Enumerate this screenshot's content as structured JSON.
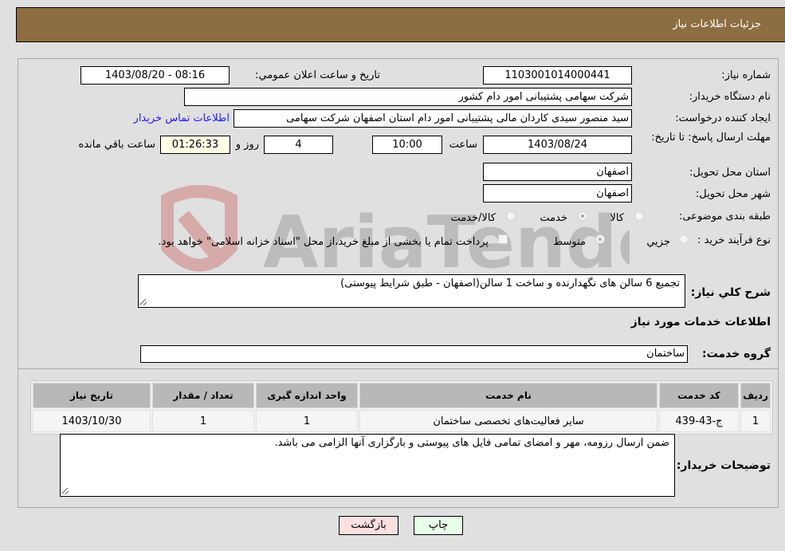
{
  "header": {
    "title": "جزئیات اطلاعات نیاز"
  },
  "form": {
    "need_number": {
      "label": "شماره نیاز:",
      "value": "1103001014000441"
    },
    "announce_datetime": {
      "label": "تاریخ و ساعت اعلان عمومي:",
      "value": "1403/08/20 - 08:16"
    },
    "buyer_org": {
      "label": "نام دستگاه خریدار:",
      "value": "شرکت سهامی پشتیبانی امور دام کشور"
    },
    "requester": {
      "label": "ایجاد کننده درخواست:",
      "value": "سید منصور سیدی کاردان مالی پشتیبانی امور دام استان اصفهان شرکت سهامی",
      "contact_link": "اطلاعات تماس خریدار"
    },
    "deadline": {
      "label": "مهلت ارسال پاسخ: تا تاریخ:",
      "date": "1403/08/24",
      "time_label": "ساعت",
      "time": "10:00",
      "days": "4",
      "days_label": "روز و",
      "remaining": "01:26:33",
      "remaining_label": "ساعت باقي مانده"
    },
    "delivery_province": {
      "label": "استان محل تحویل:",
      "value": "اصفهان"
    },
    "delivery_city": {
      "label": "شهر محل تحویل:",
      "value": "اصفهان"
    },
    "category": {
      "label": "طبقه بندی موضوعی:",
      "options": [
        {
          "label": "کالا",
          "checked": false
        },
        {
          "label": "خدمت",
          "checked": true
        },
        {
          "label": "کالا/خدمت",
          "checked": false
        }
      ]
    },
    "purchase_type": {
      "label": "نوع فرآیند خرید :",
      "options": [
        {
          "label": "جزيي",
          "checked": false
        },
        {
          "label": "متوسط",
          "checked": true
        }
      ],
      "payment_checkbox_label": "پرداخت تمام یا بخشی از مبلغ خرید،از محل \"اسناد خزانه اسلامی\" خواهد بود.",
      "payment_checked": false
    },
    "general_description": {
      "label": "شرح كلي نياز:",
      "value": "تجمیع 6 سالن های نگهدارنده و ساخت 1 سالن(اصفهان - طبق شرایط پیوستی)"
    },
    "services_section_title": "اطلاعات خدمات مورد نیاز",
    "service_group": {
      "label": "گروه خدمت:",
      "value": "ساختمان"
    }
  },
  "table": {
    "headers": [
      "ردیف",
      "کد خدمت",
      "نام خدمت",
      "واحد اندازه گیری",
      "تعداد / مقدار",
      "تاریخ نیاز"
    ],
    "rows": [
      [
        "1",
        "ج-43-439",
        "سایر فعالیت‌های تخصصی ساختمان",
        "1",
        "1",
        "1403/10/30"
      ]
    ]
  },
  "buyer_notes": {
    "label": "توضیحات خریدار:",
    "value": "ضمن ارسال رزومه، مهر و امضای تمامی فایل های پیوستی و بارگزاری آنها الزامی می باشد."
  },
  "buttons": {
    "print": "چاپ",
    "back": "بازگشت"
  },
  "watermark": {
    "text": "AriaTender.neT"
  },
  "colors": {
    "header_bg": "#8d6d42",
    "back_button_bg": "#ffe0e0",
    "print_button_bg": "#eaffea",
    "link": "#1a1aff"
  }
}
